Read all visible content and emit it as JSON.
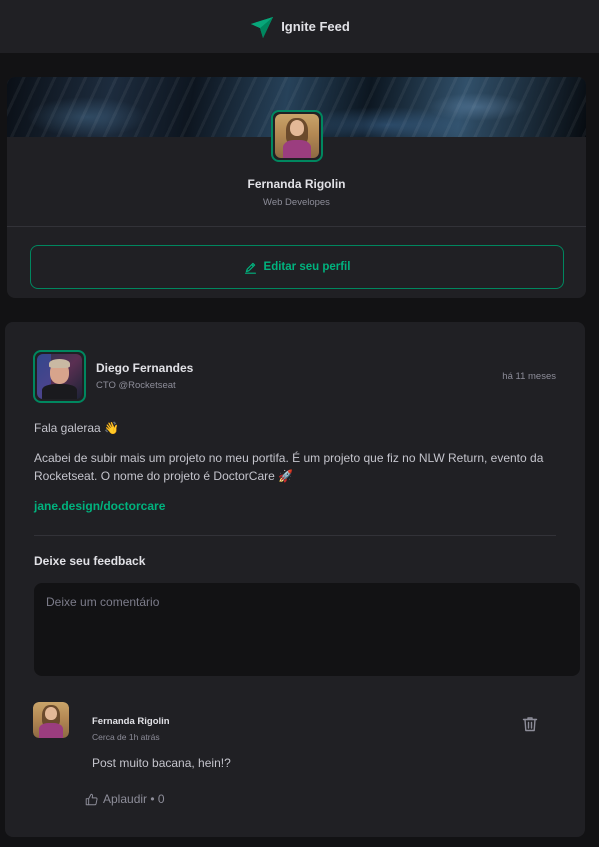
{
  "header": {
    "brand": "Ignite Feed",
    "logo_icon": "paper-plane-logo-icon"
  },
  "profile": {
    "name": "Fernanda Rigolin",
    "role": "Web Developes",
    "edit_label": "Editar seu perfil",
    "edit_icon": "pencil-icon"
  },
  "post": {
    "author_name": "Diego Fernandes",
    "author_role": "CTO @Rocketseat",
    "published": "há 11 meses",
    "paragraphs": [
      "Fala galeraa 👋",
      "Acabei de subir mais um projeto no meu portifa. É um projeto que fiz no NLW Return, evento da",
      "Rocketseat. O nome do projeto é DoctorCare 🚀"
    ],
    "link": "jane.design/doctorcare",
    "feedback_title": "Deixe seu feedback",
    "comment_placeholder": "Deixe um comentário"
  },
  "comment": {
    "author_name": "Fernanda Rigolin",
    "time": "Cerca de 1h atrás",
    "text": "Post muito bacana, hein!?",
    "applaud_label": "Aplaudir • 0",
    "delete_icon": "trash-icon",
    "applaud_icon": "thumbs-up-icon"
  },
  "colors": {
    "background": "#121214",
    "card": "#202024",
    "accent": "#00b37e",
    "accent_border": "#00875f"
  }
}
